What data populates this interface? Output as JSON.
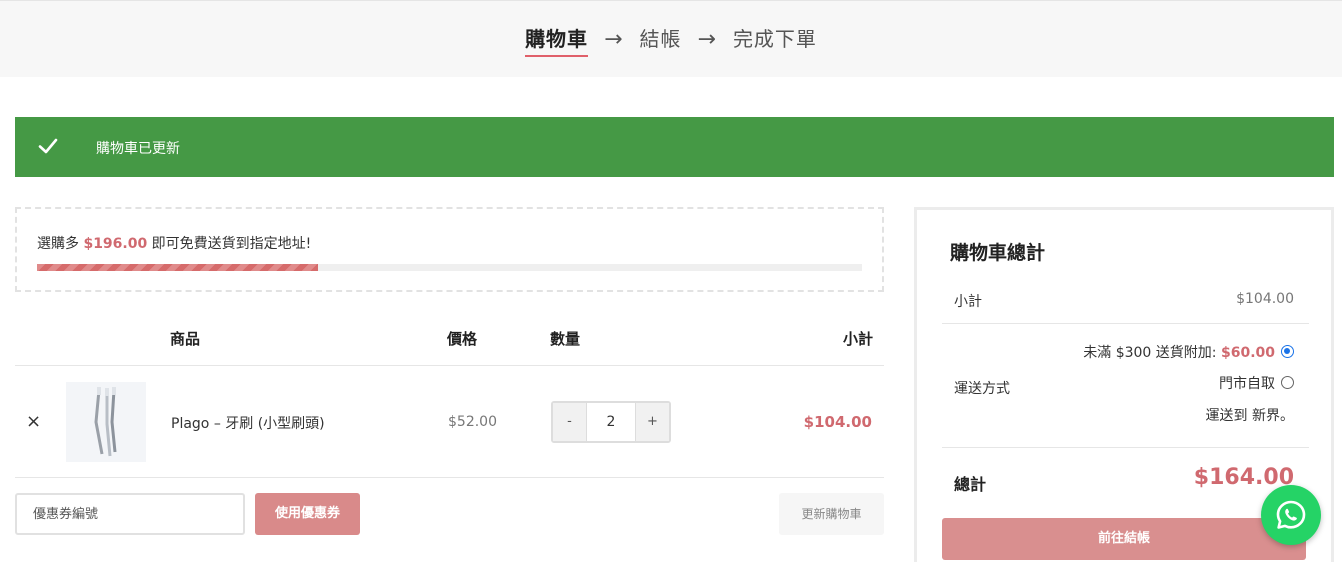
{
  "steps": {
    "cart": "購物車",
    "arrow1": "→",
    "checkout": "結帳",
    "arrow2": "→",
    "complete": "完成下單"
  },
  "notice": {
    "message": "購物車已更新",
    "icon": "check-icon"
  },
  "free_shipping": {
    "prefix": "選購多 ",
    "amount": "$196.00",
    "suffix": " 即可免費送貨到指定地址!",
    "progress": 0.34
  },
  "table": {
    "headers": {
      "product": "商品",
      "price": "價格",
      "quantity": "數量",
      "subtotal": "小計"
    },
    "items": [
      {
        "remove": "×",
        "name": "Plago – 牙刷 (小型刷頭)",
        "price": "$52.00",
        "minus": "-",
        "qty": "2",
        "plus": "+",
        "subtotal": "$104.00"
      }
    ]
  },
  "coupon": {
    "placeholder": "優惠券編號",
    "apply_label": "使用優惠券",
    "update_label": "更新購物車"
  },
  "totals": {
    "title": "購物車總計",
    "subtotal_label": "小計",
    "subtotal_value": "$104.00",
    "shipping_label": "運送方式",
    "shipping_options": [
      {
        "label": "未滿 $300 送貨附加: ",
        "fee": "$60.00",
        "selected": true
      },
      {
        "label": "門市自取",
        "fee": "",
        "selected": false
      }
    ],
    "shipping_destination": "運送到 新界。",
    "total_label": "總計",
    "total_value": "$164.00",
    "checkout_label": "前往結帳"
  },
  "colors": {
    "accent": "#d0696f",
    "notice": "#459945",
    "whatsapp": "#25d366"
  }
}
